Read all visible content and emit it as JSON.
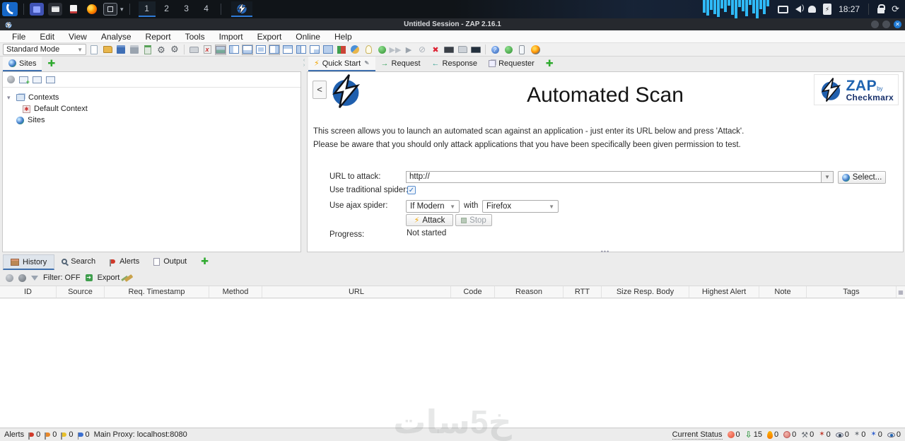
{
  "taskbar": {
    "workspaces": [
      "1",
      "2",
      "3",
      "4"
    ],
    "clock": "18:27"
  },
  "titlebar": {
    "title": "Untitled Session - ZAP 2.16.1"
  },
  "menubar": {
    "items": [
      "File",
      "Edit",
      "View",
      "Analyse",
      "Report",
      "Tools",
      "Import",
      "Export",
      "Online",
      "Help"
    ]
  },
  "toolbar": {
    "mode": "Standard Mode",
    "icons": [
      "new-session",
      "open-session",
      "save-session",
      "save-disabled",
      "persist-session",
      "session-properties",
      "options",
      "session-manage",
      "delete-session",
      "screenshot",
      "layout-left",
      "layout-bottom",
      "layout-compact",
      "layout-right",
      "layout-top",
      "layout-split",
      "layout-corner",
      "layout-full",
      "mode-blocks",
      "spider-ball",
      "hint-bulb",
      "record",
      "step-disabled",
      "play-disabled",
      "no-entry",
      "break-cross",
      "keyboard",
      "script-folder",
      "console",
      "help",
      "update",
      "mobile",
      "browser"
    ]
  },
  "sites_panel": {
    "tab_label": "Sites",
    "tree": [
      {
        "label": "Contexts"
      },
      {
        "label": "Default Context"
      },
      {
        "label": "Sites"
      }
    ]
  },
  "work_tabs": {
    "quick_start": "Quick Start",
    "request": "Request",
    "response": "Response",
    "requester": "Requester"
  },
  "quick_start": {
    "back_button": "<",
    "title": "Automated Scan",
    "description_line1": "This screen allows you to launch an automated scan against  an application - just enter its URL below and press 'Attack'.",
    "description_line2": "Please be aware that you should only attack applications that you have been specifically been given permission to test.",
    "url_label": "URL to attack:",
    "url_value": "http://",
    "select_button": "Select...",
    "traditional_spider_label": "Use traditional spider:",
    "traditional_spider_checked": "✓",
    "ajax_spider_label": "Use ajax spider:",
    "ajax_spider_value": "If Modern",
    "with_label": "with",
    "browser_value": "Firefox",
    "attack_button": "Attack",
    "stop_button": "Stop",
    "progress_label": "Progress:",
    "progress_value": "Not started",
    "logo": {
      "zap": "ZAP",
      "by": "by",
      "checkmarx": "Checkmarx"
    }
  },
  "bottom_panel": {
    "tabs": {
      "history": "History",
      "search": "Search",
      "alerts": "Alerts",
      "output": "Output"
    },
    "filter": "Filter: OFF",
    "export": "Export",
    "columns": [
      "ID",
      "Source",
      "Req. Timestamp",
      "Method",
      "URL",
      "Code",
      "Reason",
      "RTT",
      "Size Resp. Body",
      "Highest Alert",
      "Note",
      "Tags"
    ]
  },
  "status_bar": {
    "alerts_label": "Alerts",
    "alert_flags": [
      {
        "name": "flag-red",
        "color": "#d03a2b",
        "count": "0"
      },
      {
        "name": "flag-orange",
        "color": "#e8882a",
        "count": "0"
      },
      {
        "name": "flag-yellow",
        "color": "#e8c02a",
        "count": "0"
      },
      {
        "name": "flag-blue",
        "color": "#3a6fd0",
        "count": "0"
      }
    ],
    "proxy": "Main Proxy: localhost:8080",
    "current_status_label": "Current Status",
    "items": [
      {
        "name": "active-scan",
        "count": "0"
      },
      {
        "name": "passive-scan-queue",
        "count": "15"
      },
      {
        "name": "fuzzer",
        "count": "0"
      },
      {
        "name": "force-browse",
        "count": "0"
      },
      {
        "name": "access-control",
        "count": "0"
      },
      {
        "name": "spider-red",
        "count": "0"
      },
      {
        "name": "proxy-eye",
        "count": "0"
      },
      {
        "name": "spider-gray",
        "count": "0"
      },
      {
        "name": "spider-blue",
        "count": "0"
      },
      {
        "name": "passive-eye",
        "count": "0"
      }
    ]
  },
  "watermark": "خ5سات",
  "colors": {
    "accent_blue": "#3d6fae",
    "zap_blue": "#1f63b0",
    "plus_green": "#2faa2f"
  }
}
